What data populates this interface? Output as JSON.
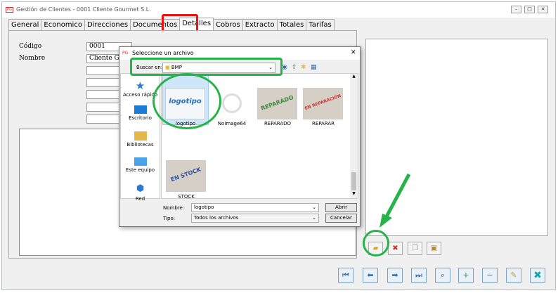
{
  "window": {
    "title": "Gestión de Clientes - 0001 Cliente Gourmet S.L.",
    "min": "–",
    "max": "□",
    "close": "✕"
  },
  "tabs": [
    "General",
    "Economico",
    "Direcciones",
    "Documentos",
    "Detalles",
    "Cobros",
    "Extracto",
    "Totales",
    "Tarifas"
  ],
  "form": {
    "codigo_label": "Código",
    "codigo_value": "0001",
    "nombre_label": "Nombre",
    "nombre_value": "Cliente Gourmet S.L."
  },
  "dialog": {
    "title": "Seleccione un archivo",
    "buscar_label": "Buscar en:",
    "folder": "BMP",
    "sidebar": [
      "Acceso rápido",
      "Escritorio",
      "Bibliotecas",
      "Este equipo",
      "Red"
    ],
    "files": [
      "logotipo",
      "NoImage64",
      "REPARADO",
      "REPARAR",
      "STOCK"
    ],
    "thumb_text": {
      "logotipo": "logotipo",
      "reparado": "REPARADO",
      "reparar": "EN REPARACIÓN",
      "stock": "EN STOCK"
    },
    "nombre_label": "Nombre:",
    "nombre_value": "logotipo",
    "tipo_label": "Tipo:",
    "tipo_value": "Todos los archivos",
    "open_label": "Abrir",
    "cancel_label": "Cancelar"
  },
  "colors": {
    "highlight_red": "#e11111",
    "highlight_green": "#26b34a",
    "nav_blue": "#3a6ea5"
  }
}
